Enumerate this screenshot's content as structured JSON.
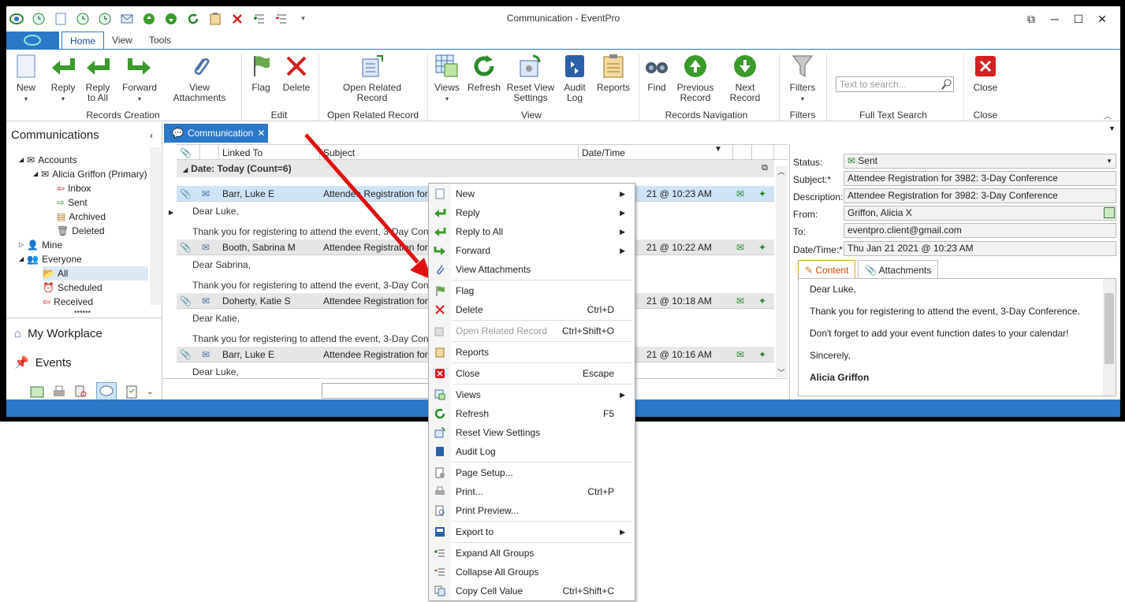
{
  "window": {
    "title": "Communication - EventPro"
  },
  "tabs": [
    "Home",
    "View",
    "Tools"
  ],
  "ribbon": {
    "buttons": {
      "new": "New",
      "reply": "Reply",
      "reply_all": "Reply to All",
      "forward": "Forward",
      "view_attachments": "View Attachments",
      "flag": "Flag",
      "delete": "Delete",
      "open_related": "Open Related Record",
      "views": "Views",
      "refresh": "Refresh",
      "reset_view": "Reset View Settings",
      "audit_log": "Audit Log",
      "reports": "Reports",
      "find": "Find",
      "previous_record": "Previous Record",
      "next_record": "Next Record",
      "filters": "Filters",
      "close": "Close"
    },
    "groups": {
      "records_creation": "Records Creation",
      "edit": "Edit",
      "open_related": "Open Related Record",
      "view": "View",
      "records_navigation": "Records Navigation",
      "filters": "Filters",
      "full_text_search": "Full Text Search",
      "close": "Close"
    },
    "search_placeholder": "Text to search..."
  },
  "left_pane": {
    "title": "Communications",
    "tree": {
      "accounts": "Accounts",
      "account_name": "Alicia Griffon (Primary)",
      "inbox": "Inbox",
      "sent": "Sent",
      "archived": "Archived",
      "deleted": "Deleted",
      "mine": "Mine",
      "everyone": "Everyone",
      "all": "All",
      "scheduled": "Scheduled",
      "received": "Received"
    },
    "nav": {
      "workplace": "My Workplace",
      "events": "Events"
    }
  },
  "doc_tab": "Communication",
  "grid": {
    "headers": {
      "linked_to": "Linked To",
      "subject": "Subject",
      "datetime": "Date/Time"
    },
    "group": "Date: Today (Count=6)",
    "rows": [
      {
        "linked": "Barr, Luke E",
        "subject": "Attendee Registration for 3",
        "time": "21 @ 10:23 AM",
        "greeting": "Dear Luke,",
        "body": "Thank you for registering to attend the event, 3-Day Conference"
      },
      {
        "linked": "Booth, Sabrina M",
        "subject": "Attendee Registration for 3",
        "time": "21 @ 10:22 AM",
        "greeting": "Dear Sabrina,",
        "body": "Thank you for registering to attend the event, 3-Day Conference"
      },
      {
        "linked": "Doherty, Katie S",
        "subject": "Attendee Registration for 3",
        "time": "21 @ 10:18 AM",
        "greeting": "Dear Katie,",
        "body": "Thank you for registering to attend the event, 3-Day Conference"
      },
      {
        "linked": "Barr, Luke E",
        "subject": "Attendee Registration for 3",
        "time": "21 @ 10:16 AM",
        "greeting": "Dear Luke,",
        "body": ""
      }
    ]
  },
  "detail": {
    "status_label": "Status:",
    "status": "Sent",
    "subject_label": "Subject:*",
    "subject": "Attendee Registration for 3982: 3-Day Conference",
    "description_label": "Description:",
    "description": "Attendee Registration for 3982: 3-Day Conference",
    "from_label": "From:",
    "from": "Griffon, Alicia X",
    "to_label": "To:",
    "to": "eventpro.client@gmail.com",
    "datetime_label": "Date/Time:*",
    "datetime": "Thu Jan 21 2021 @ 10:23 AM",
    "tab_content": "Content",
    "tab_attachments": "Attachments",
    "content": {
      "l1": "Dear Luke,",
      "l2": "Thank you for registering to attend the event, 3-Day Conference.",
      "l3": "Don't forget to add your event function dates to your calendar!",
      "l4": "Sincerely,",
      "l5": "Alicia Griffon"
    }
  },
  "context_menu": {
    "new": "New",
    "reply": "Reply",
    "reply_all": "Reply to All",
    "forward": "Forward",
    "view_attachments": "View Attachments",
    "flag": "Flag",
    "delete": "Delete",
    "delete_sc": "Ctrl+D",
    "open_related": "Open Related Record",
    "open_related_sc": "Ctrl+Shift+O",
    "reports": "Reports",
    "close": "Close",
    "close_sc": "Escape",
    "views": "Views",
    "refresh": "Refresh",
    "refresh_sc": "F5",
    "reset_view": "Reset View Settings",
    "audit_log": "Audit Log",
    "page_setup": "Page Setup...",
    "print": "Print...",
    "print_sc": "Ctrl+P",
    "print_preview": "Print Preview...",
    "export": "Export to",
    "expand_all": "Expand All Groups",
    "collapse_all": "Collapse All Groups",
    "copy_cell": "Copy Cell Value",
    "copy_cell_sc": "Ctrl+Shift+C"
  },
  "colors": {
    "accent": "#2b77c8",
    "green": "#3a9a2a",
    "red": "#d42020"
  }
}
